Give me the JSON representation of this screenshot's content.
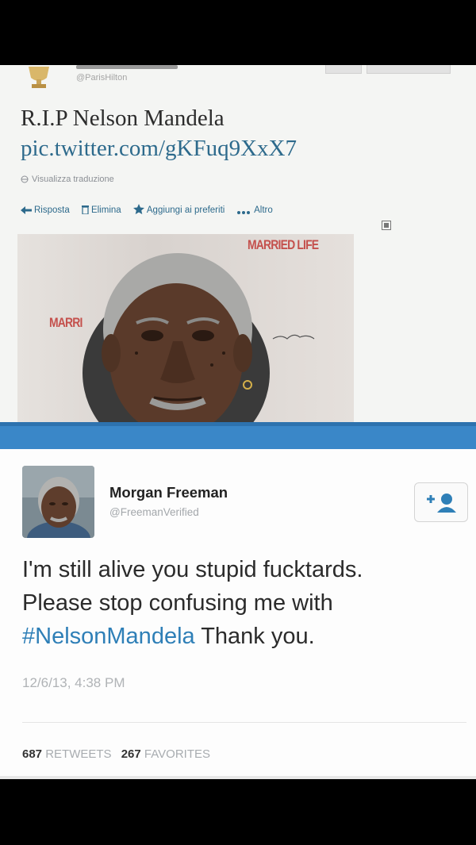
{
  "top_tweet": {
    "handle": "@ParisHilton",
    "text_line1": "R.I.P Nelson Mandela",
    "text_link": "pic.twitter.com/gKFuq9XxX7",
    "translate_label": "Visualizza traduzione",
    "actions": {
      "reply": "Risposta",
      "delete": "Elimina",
      "favorite": "Aggiungi ai preferiti",
      "more": "Altro"
    },
    "photo_text_top": "MARRIED LIFE",
    "photo_text_left": "MARRI"
  },
  "bottom_tweet": {
    "name": "Morgan Freeman",
    "handle": "@FreemanVerified",
    "body_line1": "I'm still alive you stupid fucktards.",
    "body_line2": "Please stop confusing me with",
    "hashtag": "#NelsonMandela",
    "body_line3_rest": " Thank you.",
    "timestamp": "12/6/13, 4:38 PM",
    "retweets_count": "687",
    "retweets_label": "RETWEETS",
    "favorites_count": "267",
    "favorites_label": "FAVORITES"
  },
  "colors": {
    "link": "#2d6a8c",
    "hashtag": "#2e7fb7",
    "separator": "#3a87c8",
    "background": "#000000"
  }
}
